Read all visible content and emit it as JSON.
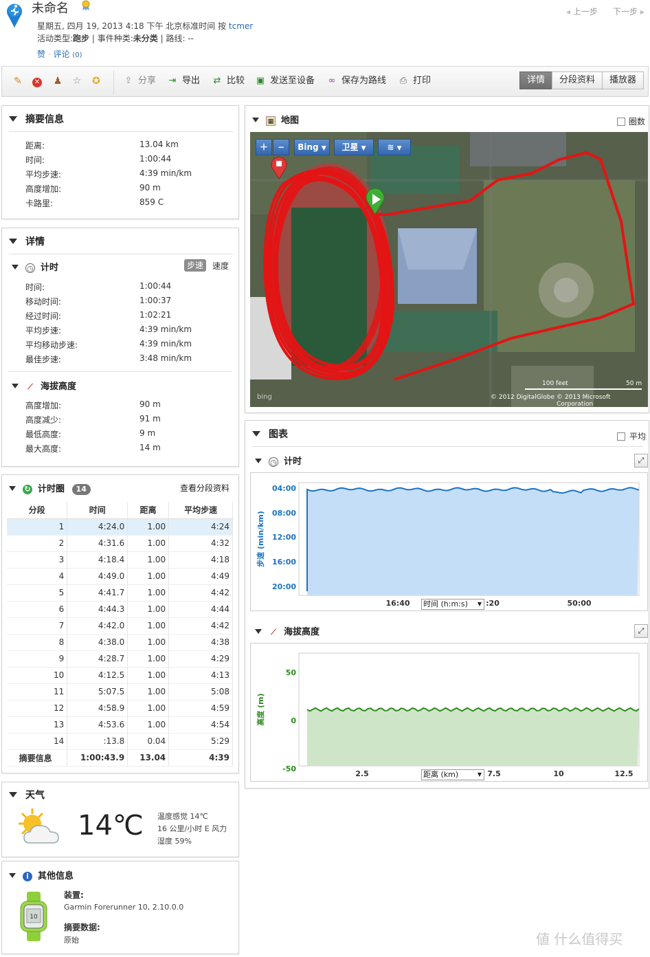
{
  "header": {
    "title": "未命名",
    "meta_line1": "星期五, 四月 19, 2013 4:18 下午 北京标准时间 按",
    "user": "tcmer",
    "activity_type_label": "活动类型:",
    "activity_type": "跑步",
    "event_type_label": "| 事件种类:",
    "event_type": "未分类",
    "route_label": "| 路线: --",
    "like": "赞",
    "comment": "评论",
    "comment_count": "(0)",
    "prev": "上一步",
    "next": "下一步"
  },
  "toolbar": {
    "share": "分享",
    "export": "导出",
    "compare": "比较",
    "send": "发送至设备",
    "save_route": "保存为路线",
    "print": "打印",
    "tabs": [
      "详情",
      "分段资料",
      "播放器"
    ]
  },
  "summary": {
    "title": "摘要信息",
    "rows": [
      {
        "label": "距离:",
        "value": "13.04 km"
      },
      {
        "label": "时间:",
        "value": "1:00:44"
      },
      {
        "label": "平均步速:",
        "value": "4:39 min/km"
      },
      {
        "label": "高度增加:",
        "value": "90 m"
      },
      {
        "label": "卡路里:",
        "value": "859 C"
      }
    ]
  },
  "details": {
    "title": "详情",
    "timing_title": "计时",
    "toggle_pace": "步速",
    "toggle_speed": "速度",
    "timing_rows": [
      {
        "label": "时间:",
        "value": "1:00:44"
      },
      {
        "label": "移动时间:",
        "value": "1:00:37"
      },
      {
        "label": "经过时间:",
        "value": "1:02:21"
      },
      {
        "label": "平均步速:",
        "value": "4:39 min/km"
      },
      {
        "label": "平均移动步速:",
        "value": "4:39 min/km"
      },
      {
        "label": "最佳步速:",
        "value": "3:48 min/km"
      }
    ],
    "elev_title": "海拔高度",
    "elev_rows": [
      {
        "label": "高度增加:",
        "value": "90 m"
      },
      {
        "label": "高度减少:",
        "value": "91 m"
      },
      {
        "label": "最低高度:",
        "value": "9 m"
      },
      {
        "label": "最大高度:",
        "value": "14 m"
      }
    ]
  },
  "laps": {
    "title": "计时圈",
    "count": "14",
    "view_link": "查看分段资料",
    "headers": [
      "分段",
      "时间",
      "距离",
      "平均步速"
    ],
    "rows": [
      [
        "1",
        "4:24.0",
        "1.00",
        "4:24"
      ],
      [
        "2",
        "4:31.6",
        "1.00",
        "4:32"
      ],
      [
        "3",
        "4:18.4",
        "1.00",
        "4:18"
      ],
      [
        "4",
        "4:49.0",
        "1.00",
        "4:49"
      ],
      [
        "5",
        "4:41.7",
        "1.00",
        "4:42"
      ],
      [
        "6",
        "4:44.3",
        "1.00",
        "4:44"
      ],
      [
        "7",
        "4:42.0",
        "1.00",
        "4:42"
      ],
      [
        "8",
        "4:38.0",
        "1.00",
        "4:38"
      ],
      [
        "9",
        "4:28.7",
        "1.00",
        "4:29"
      ],
      [
        "10",
        "4:12.5",
        "1.00",
        "4:13"
      ],
      [
        "11",
        "5:07.5",
        "1.00",
        "5:08"
      ],
      [
        "12",
        "4:58.9",
        "1.00",
        "4:59"
      ],
      [
        "13",
        "4:53.6",
        "1.00",
        "4:54"
      ],
      [
        "14",
        ":13.8",
        "0.04",
        "5:29"
      ]
    ],
    "summary_row": [
      "摘要信息",
      "1:00:43.9",
      "13.04",
      "4:39"
    ]
  },
  "weather": {
    "title": "天气",
    "temp": "14℃",
    "feels": "温度感觉 14℃",
    "wind": "16 公里/小时 E 风力",
    "humidity": "湿度 59%"
  },
  "other": {
    "title": "其他信息",
    "device_label": "装置:",
    "device": "Garmin Forerunner 10, 2.10.0.0",
    "data_label": "摘要数据:",
    "data": "原始"
  },
  "map_panel": {
    "title": "地图",
    "circle_label": "圈数",
    "provider": "Bing",
    "view": "卫星",
    "scale_ft": "100 feet",
    "scale_m": "50 m",
    "copyright1": "© 2012 DigitalGlobe",
    "copyright2": "© 2013 Microsoft Corporation",
    "bing_logo": "bing"
  },
  "charts_panel": {
    "title": "图表",
    "avg_label": "平均"
  },
  "chart_data": [
    {
      "type": "area",
      "title": "计时",
      "ylabel": "步速 (min/km)",
      "xlabel": "时间 (h:m:s)",
      "x_ticks": [
        "16:40",
        ":20",
        "50:00"
      ],
      "y_ticks": [
        "04:00",
        "08:00",
        "12:00",
        "16:00",
        "20:00"
      ],
      "y_reversed": true,
      "color": "#1a73c8",
      "fill": "#c5def7"
    },
    {
      "type": "area",
      "title": "海拔高度",
      "ylabel": "高度 (m)",
      "xlabel": "距离 (km)",
      "x_ticks": [
        "2.5",
        "7.5",
        "10",
        "12.5"
      ],
      "y_ticks": [
        "50",
        "0",
        "-50"
      ],
      "ylim": [
        -50,
        50
      ],
      "color": "#2e8b1f",
      "fill": "#cfe5c8"
    }
  ]
}
